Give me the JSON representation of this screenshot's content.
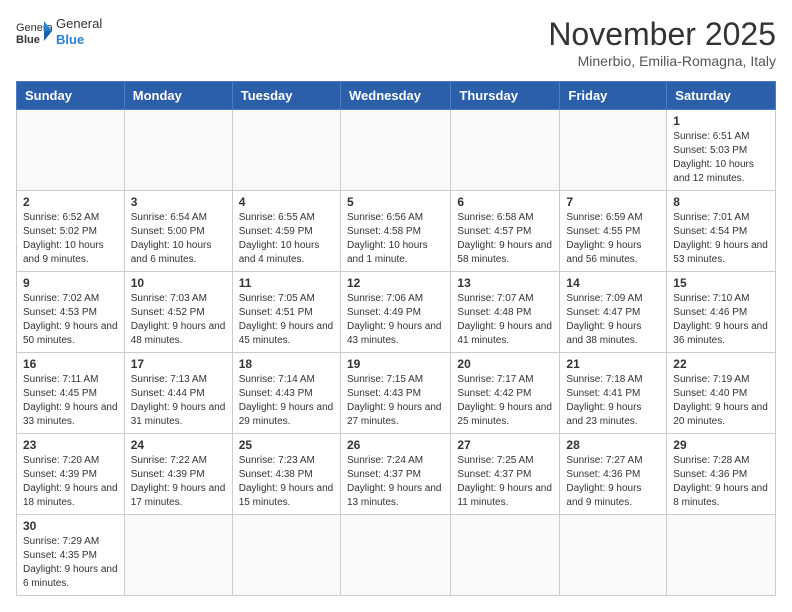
{
  "header": {
    "logo_text_normal": "General",
    "logo_text_bold": "Blue",
    "month_title": "November 2025",
    "subtitle": "Minerbio, Emilia-Romagna, Italy"
  },
  "days_of_week": [
    "Sunday",
    "Monday",
    "Tuesday",
    "Wednesday",
    "Thursday",
    "Friday",
    "Saturday"
  ],
  "weeks": [
    [
      {
        "day": "",
        "info": ""
      },
      {
        "day": "",
        "info": ""
      },
      {
        "day": "",
        "info": ""
      },
      {
        "day": "",
        "info": ""
      },
      {
        "day": "",
        "info": ""
      },
      {
        "day": "",
        "info": ""
      },
      {
        "day": "1",
        "info": "Sunrise: 6:51 AM\nSunset: 5:03 PM\nDaylight: 10 hours and 12 minutes."
      }
    ],
    [
      {
        "day": "2",
        "info": "Sunrise: 6:52 AM\nSunset: 5:02 PM\nDaylight: 10 hours and 9 minutes."
      },
      {
        "day": "3",
        "info": "Sunrise: 6:54 AM\nSunset: 5:00 PM\nDaylight: 10 hours and 6 minutes."
      },
      {
        "day": "4",
        "info": "Sunrise: 6:55 AM\nSunset: 4:59 PM\nDaylight: 10 hours and 4 minutes."
      },
      {
        "day": "5",
        "info": "Sunrise: 6:56 AM\nSunset: 4:58 PM\nDaylight: 10 hours and 1 minute."
      },
      {
        "day": "6",
        "info": "Sunrise: 6:58 AM\nSunset: 4:57 PM\nDaylight: 9 hours and 58 minutes."
      },
      {
        "day": "7",
        "info": "Sunrise: 6:59 AM\nSunset: 4:55 PM\nDaylight: 9 hours and 56 minutes."
      },
      {
        "day": "8",
        "info": "Sunrise: 7:01 AM\nSunset: 4:54 PM\nDaylight: 9 hours and 53 minutes."
      }
    ],
    [
      {
        "day": "9",
        "info": "Sunrise: 7:02 AM\nSunset: 4:53 PM\nDaylight: 9 hours and 50 minutes."
      },
      {
        "day": "10",
        "info": "Sunrise: 7:03 AM\nSunset: 4:52 PM\nDaylight: 9 hours and 48 minutes."
      },
      {
        "day": "11",
        "info": "Sunrise: 7:05 AM\nSunset: 4:51 PM\nDaylight: 9 hours and 45 minutes."
      },
      {
        "day": "12",
        "info": "Sunrise: 7:06 AM\nSunset: 4:49 PM\nDaylight: 9 hours and 43 minutes."
      },
      {
        "day": "13",
        "info": "Sunrise: 7:07 AM\nSunset: 4:48 PM\nDaylight: 9 hours and 41 minutes."
      },
      {
        "day": "14",
        "info": "Sunrise: 7:09 AM\nSunset: 4:47 PM\nDaylight: 9 hours and 38 minutes."
      },
      {
        "day": "15",
        "info": "Sunrise: 7:10 AM\nSunset: 4:46 PM\nDaylight: 9 hours and 36 minutes."
      }
    ],
    [
      {
        "day": "16",
        "info": "Sunrise: 7:11 AM\nSunset: 4:45 PM\nDaylight: 9 hours and 33 minutes."
      },
      {
        "day": "17",
        "info": "Sunrise: 7:13 AM\nSunset: 4:44 PM\nDaylight: 9 hours and 31 minutes."
      },
      {
        "day": "18",
        "info": "Sunrise: 7:14 AM\nSunset: 4:43 PM\nDaylight: 9 hours and 29 minutes."
      },
      {
        "day": "19",
        "info": "Sunrise: 7:15 AM\nSunset: 4:43 PM\nDaylight: 9 hours and 27 minutes."
      },
      {
        "day": "20",
        "info": "Sunrise: 7:17 AM\nSunset: 4:42 PM\nDaylight: 9 hours and 25 minutes."
      },
      {
        "day": "21",
        "info": "Sunrise: 7:18 AM\nSunset: 4:41 PM\nDaylight: 9 hours and 23 minutes."
      },
      {
        "day": "22",
        "info": "Sunrise: 7:19 AM\nSunset: 4:40 PM\nDaylight: 9 hours and 20 minutes."
      }
    ],
    [
      {
        "day": "23",
        "info": "Sunrise: 7:20 AM\nSunset: 4:39 PM\nDaylight: 9 hours and 18 minutes."
      },
      {
        "day": "24",
        "info": "Sunrise: 7:22 AM\nSunset: 4:39 PM\nDaylight: 9 hours and 17 minutes."
      },
      {
        "day": "25",
        "info": "Sunrise: 7:23 AM\nSunset: 4:38 PM\nDaylight: 9 hours and 15 minutes."
      },
      {
        "day": "26",
        "info": "Sunrise: 7:24 AM\nSunset: 4:37 PM\nDaylight: 9 hours and 13 minutes."
      },
      {
        "day": "27",
        "info": "Sunrise: 7:25 AM\nSunset: 4:37 PM\nDaylight: 9 hours and 11 minutes."
      },
      {
        "day": "28",
        "info": "Sunrise: 7:27 AM\nSunset: 4:36 PM\nDaylight: 9 hours and 9 minutes."
      },
      {
        "day": "29",
        "info": "Sunrise: 7:28 AM\nSunset: 4:36 PM\nDaylight: 9 hours and 8 minutes."
      }
    ],
    [
      {
        "day": "30",
        "info": "Sunrise: 7:29 AM\nSunset: 4:35 PM\nDaylight: 9 hours and 6 minutes."
      },
      {
        "day": "",
        "info": ""
      },
      {
        "day": "",
        "info": ""
      },
      {
        "day": "",
        "info": ""
      },
      {
        "day": "",
        "info": ""
      },
      {
        "day": "",
        "info": ""
      },
      {
        "day": "",
        "info": ""
      }
    ]
  ]
}
